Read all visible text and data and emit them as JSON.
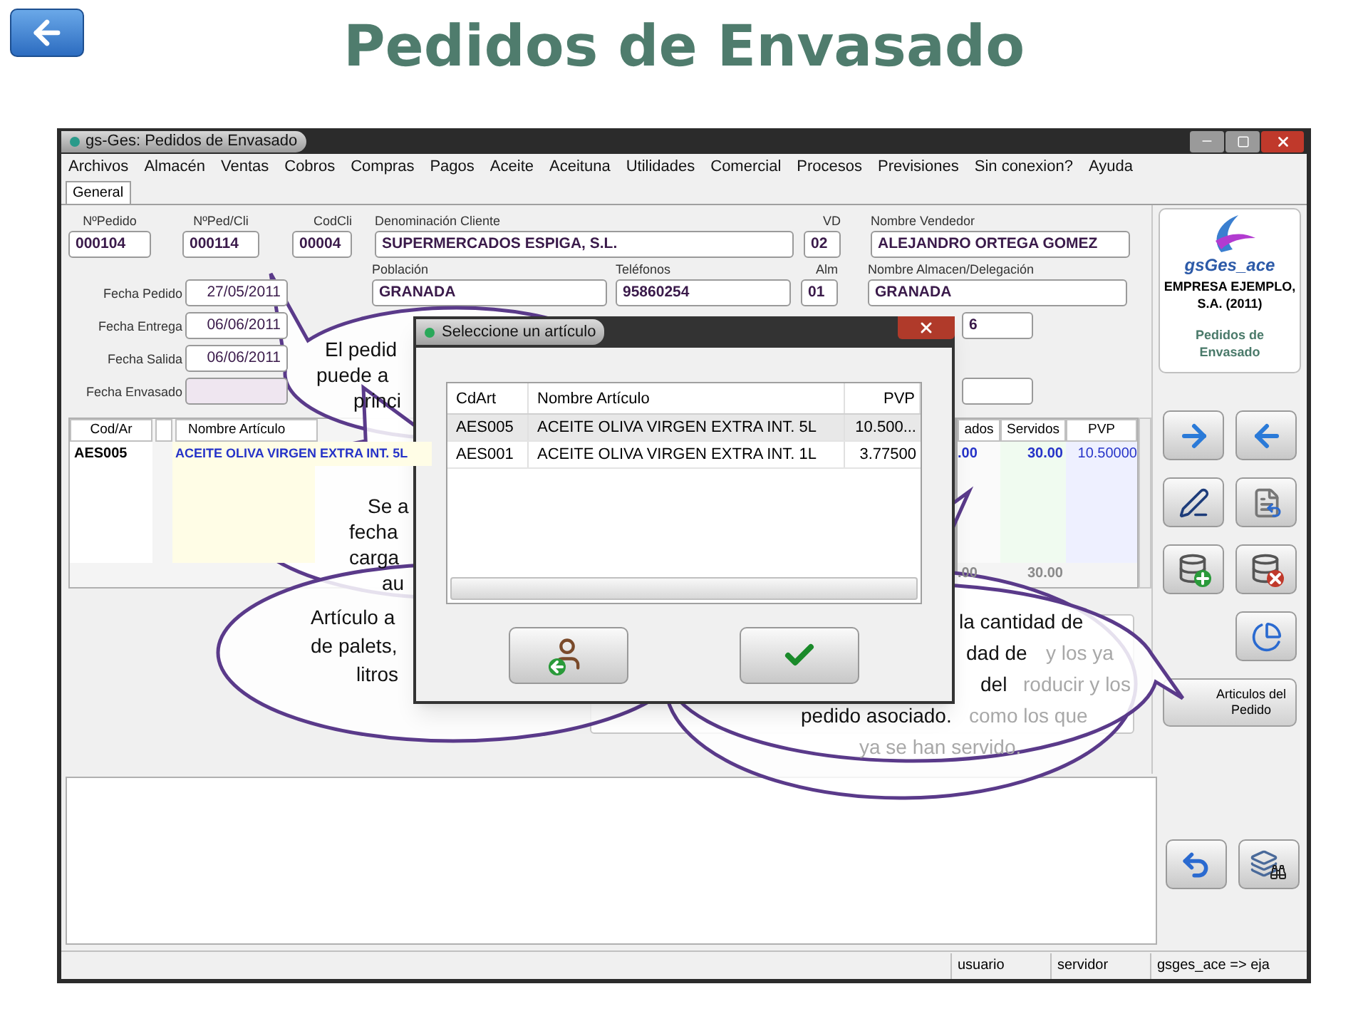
{
  "slide": {
    "title": "Pedidos de Envasado"
  },
  "window": {
    "title": "gs-Ges: Pedidos de Envasado"
  },
  "menu": [
    "Archivos",
    "Almacén",
    "Ventas",
    "Cobros",
    "Compras",
    "Pagos",
    "Aceite",
    "Aceituna",
    "Utilidades",
    "Comercial",
    "Procesos",
    "Previsiones",
    "Sin conexion?",
    "Ayuda"
  ],
  "tabs": [
    {
      "label": "General",
      "selected": true
    }
  ],
  "header": [
    {
      "label": "NºPedido",
      "value": "000104"
    },
    {
      "label": "NºPed/Cli",
      "value": "000114"
    },
    {
      "label": "CodCli",
      "value": "00004"
    },
    {
      "label": "Denominación Cliente",
      "value": "SUPERMERCADOS ESPIGA, S.L."
    },
    {
      "label": "VD",
      "value": "02"
    },
    {
      "label": "Nombre Vendedor",
      "value": "ALEJANDRO ORTEGA GOMEZ"
    }
  ],
  "header_row_2": [
    {
      "label": "Población",
      "value": "GRANADA"
    },
    {
      "label": "Teléfonos",
      "value": "95860254"
    },
    {
      "label": "Alm",
      "value": "01"
    },
    {
      "label": "Nombre Almacen/Delegación",
      "value": "GRANADA"
    }
  ],
  "dates": [
    {
      "label": "Fecha Pedido",
      "value": "27/05/2011"
    },
    {
      "label": "Fecha Entrega",
      "value": "06/06/2011"
    },
    {
      "label": "Fecha Salida",
      "value": "06/06/2011"
    },
    {
      "label": "Fecha Envasado"
    }
  ],
  "side_field": {
    "value": "6"
  },
  "lines_table": {
    "columns_left": [
      "Cod/Ar",
      "Nombre Artículo"
    ],
    "columns_right": [
      "ados",
      "Servidos",
      "PVP"
    ],
    "rows": [
      {
        "code": "AES005",
        "name": "ACEITE OLIVA VIRGEN EXTRA INT. 5L",
        "column_6": ".00",
        "servidos": "30.00",
        "pvp": "10.50000"
      }
    ],
    "totals": [
      ".00",
      "30.00"
    ]
  },
  "company_card": {
    "app": "gsGes_ace",
    "company": "EMPRESA EJEMPLO, S.A. (2011)",
    "module": "Pedidos de Envasado"
  },
  "articles_button": "Articulos del Pedido",
  "status_bar": [
    "usuario",
    "servidor",
    "gsges_ace => eja"
  ],
  "dialog": {
    "title": "Seleccione un artículo",
    "columns": [
      "CdArt",
      "Nombre Artículo",
      "PVP"
    ],
    "rows": [
      {
        "code": "AES005",
        "name": "ACEITE OLIVA VIRGEN EXTRA INT. 5L",
        "pvp": "10.500...",
        "selected": true
      },
      {
        "code": "AES001",
        "name": "ACEITE OLIVA VIRGEN EXTRA INT. 1L",
        "pvp": "3.77500",
        "selected": false
      }
    ]
  },
  "callouts": [
    {
      "lines": [
        "El pedid",
        "puede a",
        "princi"
      ]
    },
    {
      "lines": [
        "Se a",
        "fecha",
        "carga",
        "au"
      ]
    },
    {
      "lines": [
        "Artículo a",
        "de palets,",
        "litros"
      ]
    },
    {
      "lines": [
        "la cantidad de",
        "dad de",
        "del",
        "pedido asociado."
      ],
      "faded_lines": [
        "y los ya",
        "roducir y los",
        "como los que",
        "ya se han servido."
      ]
    }
  ]
}
